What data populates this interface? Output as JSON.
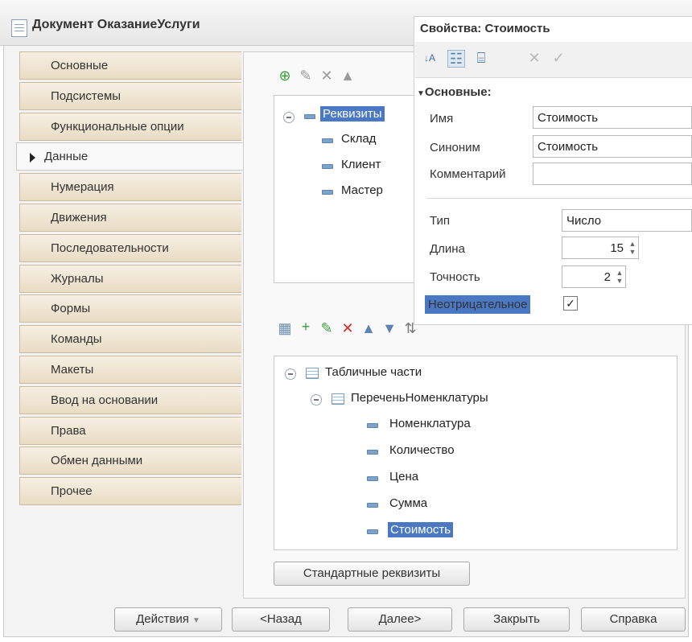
{
  "window": {
    "title": "Документ ОказаниеУслуги"
  },
  "tabs": [
    {
      "label": "Основные",
      "active": false
    },
    {
      "label": "Подсистемы",
      "active": false
    },
    {
      "label": "Функциональные опции",
      "active": false
    },
    {
      "label": "Данные",
      "active": true
    },
    {
      "label": "Нумерация",
      "active": false
    },
    {
      "label": "Движения",
      "active": false
    },
    {
      "label": "Последовательности",
      "active": false
    },
    {
      "label": "Журналы",
      "active": false
    },
    {
      "label": "Формы",
      "active": false
    },
    {
      "label": "Команды",
      "active": false
    },
    {
      "label": "Макеты",
      "active": false
    },
    {
      "label": "Ввод на основании",
      "active": false
    },
    {
      "label": "Права",
      "active": false
    },
    {
      "label": "Обмен данными",
      "active": false
    },
    {
      "label": "Прочее",
      "active": false
    }
  ],
  "attributes_tree": {
    "root": "Реквизиты",
    "items": [
      "Склад",
      "Клиент",
      "Мастер"
    ]
  },
  "tabular_tree": {
    "root": "Табличные части",
    "section": "ПереченьНоменклатуры",
    "items": [
      "Номенклатура",
      "Количество",
      "Цена",
      "Сумма",
      "Стоимость"
    ],
    "selected": "Стоимость"
  },
  "standard_attributes_button": "Стандартные реквизиты",
  "footer": {
    "actions": "Действия",
    "back": "<Назад",
    "next": "Далее>",
    "close": "Закрыть",
    "help": "Справка"
  },
  "properties": {
    "title": "Свойства: Стоимость",
    "group": "Основные:",
    "name_label": "Имя",
    "name_value": "Стоимость",
    "synonym_label": "Синоним",
    "synonym_value": "Стоимость",
    "comment_label": "Комментарий",
    "comment_value": "",
    "type_label": "Тип",
    "type_value": "Число",
    "length_label": "Длина",
    "length_value": "15",
    "precision_label": "Точность",
    "precision_value": "2",
    "nonnegative_label": "Неотрицательное",
    "nonnegative_checked": true
  },
  "colors": {
    "selection": "#4a78c2",
    "tab_bg": "#efe4cf"
  }
}
